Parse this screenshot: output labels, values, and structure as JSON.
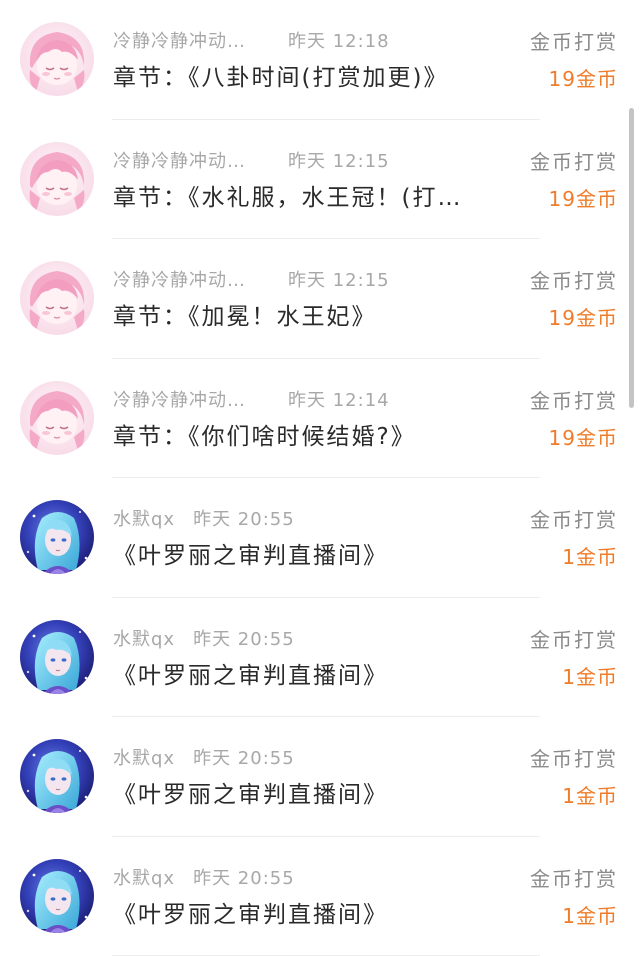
{
  "items": [
    {
      "avatar": "pink-anime-avatar",
      "name": "冷静冷静冲动…",
      "time": "昨天 12:18",
      "title": "章节：《八卦时间(打赏加更)》",
      "type": "金币打赏",
      "amount": "19金币"
    },
    {
      "avatar": "pink-anime-avatar",
      "name": "冷静冷静冲动…",
      "time": "昨天 12:15",
      "title": "章节：《水礼服，水王冠！(打…",
      "type": "金币打赏",
      "amount": "19金币"
    },
    {
      "avatar": "pink-anime-avatar",
      "name": "冷静冷静冲动…",
      "time": "昨天 12:15",
      "title": "章节：《加冕！水王妃》",
      "type": "金币打赏",
      "amount": "19金币"
    },
    {
      "avatar": "pink-anime-avatar",
      "name": "冷静冷静冲动…",
      "time": "昨天 12:14",
      "title": "章节：《你们啥时候结婚?》",
      "type": "金币打赏",
      "amount": "19金币"
    },
    {
      "avatar": "blue-anime-avatar",
      "name": "水默qx",
      "time": "昨天 20:55",
      "title": "《叶罗丽之审判直播间》",
      "type": "金币打赏",
      "amount": "1金币"
    },
    {
      "avatar": "blue-anime-avatar",
      "name": "水默qx",
      "time": "昨天 20:55",
      "title": "《叶罗丽之审判直播间》",
      "type": "金币打赏",
      "amount": "1金币"
    },
    {
      "avatar": "blue-anime-avatar",
      "name": "水默qx",
      "time": "昨天 20:55",
      "title": "《叶罗丽之审判直播间》",
      "type": "金币打赏",
      "amount": "1金币"
    },
    {
      "avatar": "blue-anime-avatar",
      "name": "水默qx",
      "time": "昨天 20:55",
      "title": "《叶罗丽之审判直播间》",
      "type": "金币打赏",
      "amount": "1金币"
    }
  ],
  "colors": {
    "amount": "#f07c2a",
    "meta": "#a8a8a8",
    "title": "#2a2a2a",
    "type": "#8a8a8a"
  }
}
